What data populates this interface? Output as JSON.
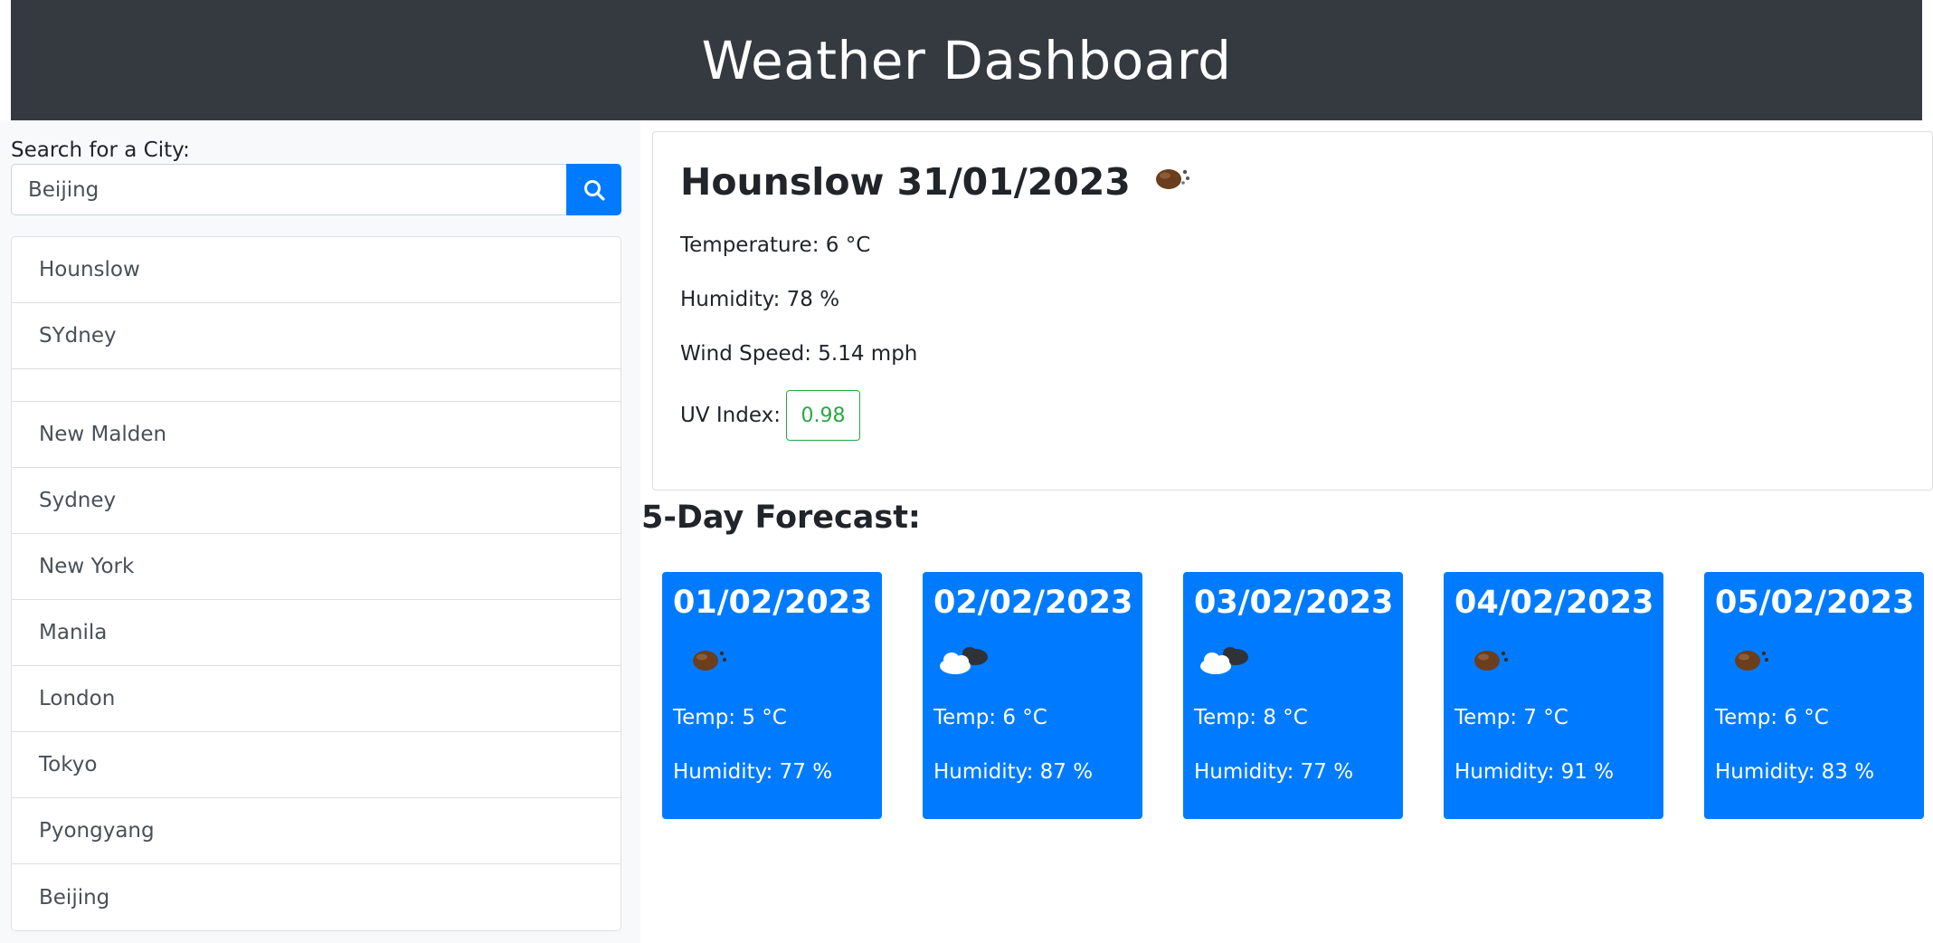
{
  "header": {
    "title": "Weather Dashboard"
  },
  "search": {
    "label": "Search for a City:",
    "value": "Beijing",
    "button_icon": "search-icon"
  },
  "history": [
    "Hounslow",
    "SYdney",
    "",
    "New Malden",
    "Sydney",
    "New York",
    "Manila",
    "London",
    "Tokyo",
    "Pyongyang",
    "Beijing"
  ],
  "current": {
    "title": "Hounslow 31/01/2023",
    "icon": "rain-icon",
    "temperature": "Temperature: 6 °C",
    "humidity": "Humidity: 78 %",
    "wind": "Wind Speed: 5.14 mph",
    "uv_label": "UV Index:",
    "uv_value": "0.98"
  },
  "forecast": {
    "title": "5-Day Forecast:",
    "days": [
      {
        "date": "01/02/2023",
        "icon": "rain-icon",
        "temp": "Temp: 5 °C",
        "humidity": "Humidity: 77 %"
      },
      {
        "date": "02/02/2023",
        "icon": "cloud-icon",
        "temp": "Temp: 6 °C",
        "humidity": "Humidity: 87 %"
      },
      {
        "date": "03/02/2023",
        "icon": "cloud-icon",
        "temp": "Temp: 8 °C",
        "humidity": "Humidity: 77 %"
      },
      {
        "date": "04/02/2023",
        "icon": "rain-icon",
        "temp": "Temp: 7 °C",
        "humidity": "Humidity: 91 %"
      },
      {
        "date": "05/02/2023",
        "icon": "rain-icon",
        "temp": "Temp: 6 °C",
        "humidity": "Humidity: 83 %"
      }
    ]
  },
  "colors": {
    "header_bg": "#343a40",
    "accent": "#007bff",
    "uv_good": "#28a745"
  }
}
